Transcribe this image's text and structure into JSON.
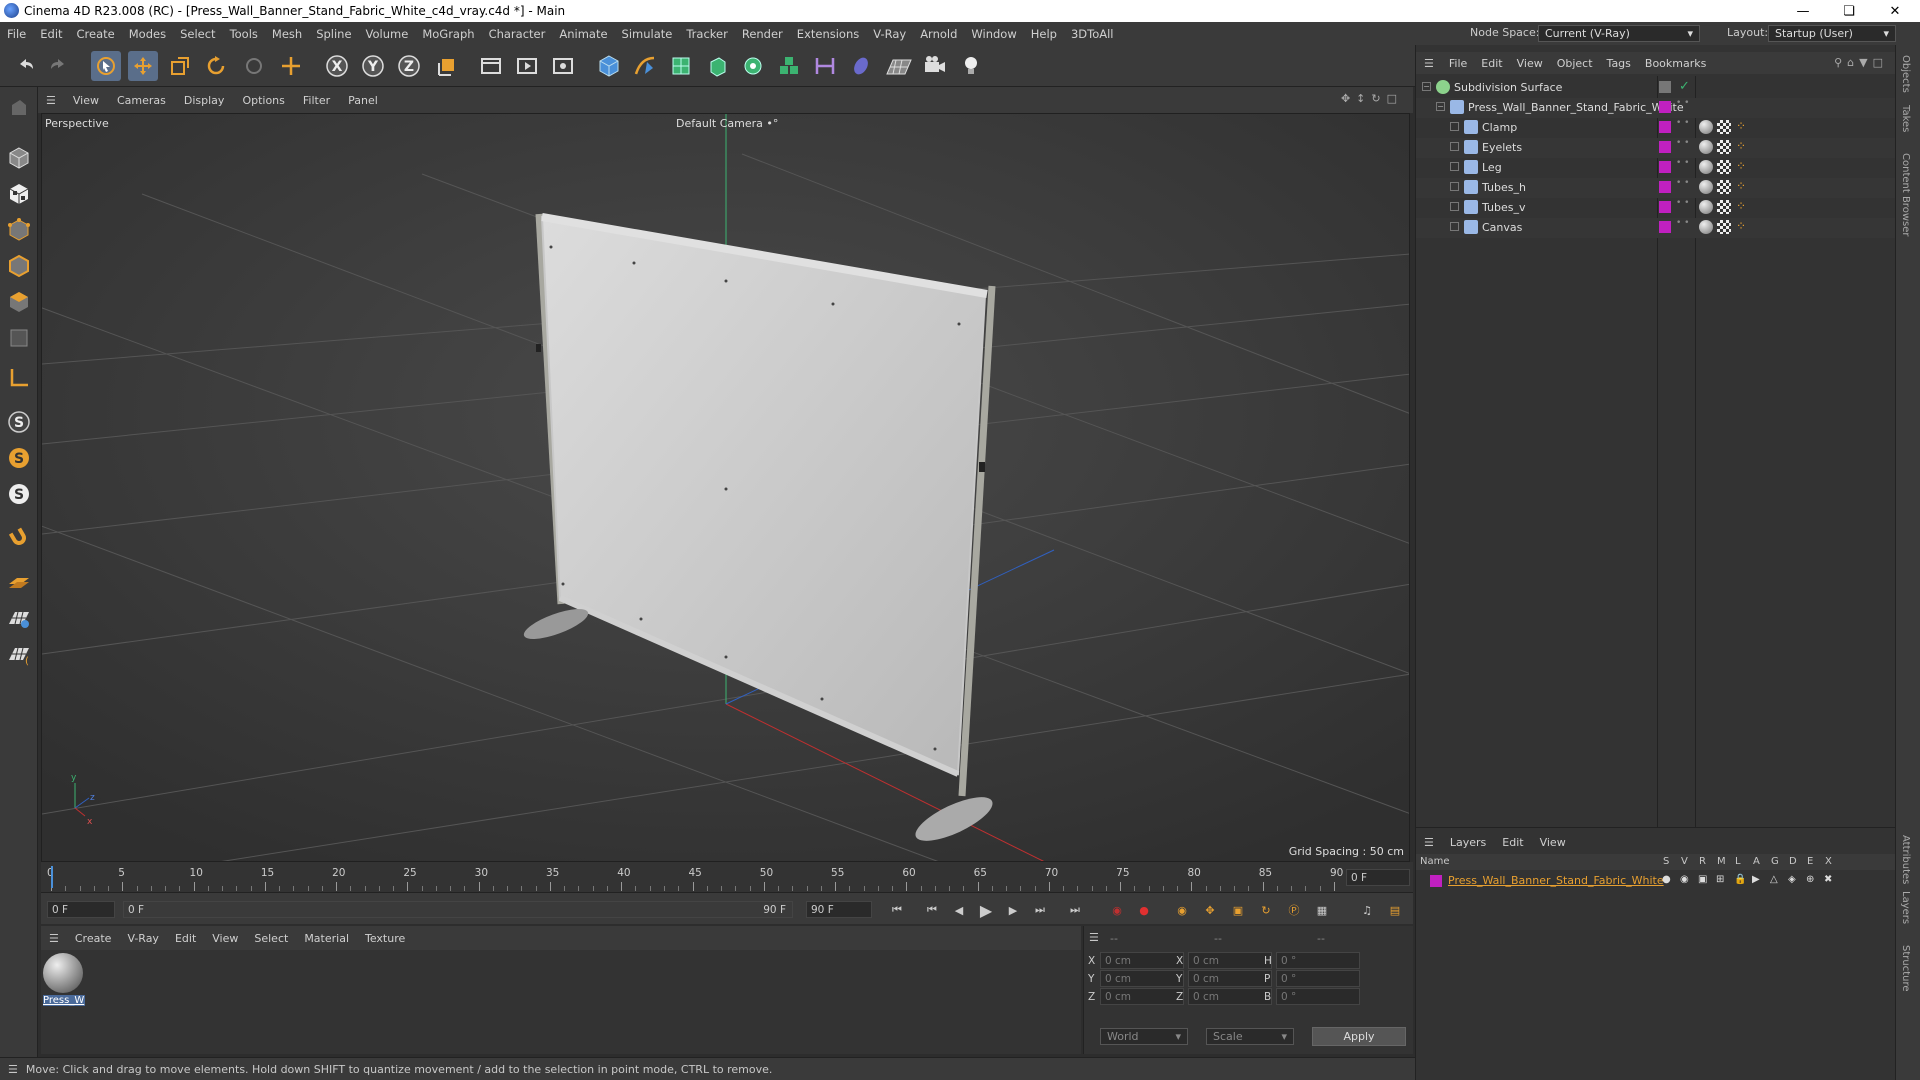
{
  "window": {
    "title": "Cinema 4D R23.008 (RC) - [Press_Wall_Banner_Stand_Fabric_White_c4d_vray.c4d *] - Main"
  },
  "menu": [
    "File",
    "Edit",
    "Create",
    "Modes",
    "Select",
    "Tools",
    "Mesh",
    "Spline",
    "Volume",
    "MoGraph",
    "Character",
    "Animate",
    "Simulate",
    "Tracker",
    "Render",
    "Extensions",
    "V-Ray",
    "Arnold",
    "Window",
    "Help",
    "3DToAll"
  ],
  "nodespace": {
    "label": "Node Space:",
    "value": "Current (V-Ray)"
  },
  "layout": {
    "label": "Layout:",
    "value": "Startup (User)"
  },
  "toolbar_icons": [
    "undo-icon",
    "redo-icon",
    "select-icon",
    "move-icon",
    "scale-icon",
    "rotate-icon",
    "live-select-icon",
    "transform-icon",
    "x-axis-icon",
    "y-axis-icon",
    "z-axis-icon",
    "coordinate-system-icon",
    "render-region-icon",
    "render-view-icon",
    "render-settings-icon",
    "cube-icon",
    "pen-icon",
    "subdivision-icon",
    "extrude-icon",
    "mograph-cloner-icon",
    "array-icon",
    "deformer-icon",
    "field-icon",
    "floor-icon",
    "camera-icon",
    "light-icon"
  ],
  "viewport": {
    "menu": [
      "View",
      "Cameras",
      "Display",
      "Options",
      "Filter",
      "Panel"
    ],
    "label": "Perspective",
    "camera": "Default Camera",
    "grid_spacing": "Grid Spacing : 50 cm"
  },
  "timeline": {
    "ticks": [
      "0",
      "5",
      "10",
      "15",
      "20",
      "25",
      "30",
      "35",
      "40",
      "45",
      "50",
      "55",
      "60",
      "65",
      "70",
      "75",
      "80",
      "85",
      "90"
    ],
    "current_frame": "0 F",
    "start": "0 F",
    "range_start": "0 F",
    "range_end": "90 F",
    "end": "90 F"
  },
  "material_menu": [
    "Create",
    "V-Ray",
    "Edit",
    "View",
    "Select",
    "Material",
    "Texture"
  ],
  "material": {
    "name": "Press_W"
  },
  "coords": {
    "header": [
      "--",
      "--",
      "--"
    ],
    "rows": [
      {
        "a": "X",
        "av": "0 cm",
        "b": "X",
        "bv": "0 cm",
        "c": "H",
        "cv": "0 °"
      },
      {
        "a": "Y",
        "av": "0 cm",
        "b": "Y",
        "bv": "0 cm",
        "c": "P",
        "cv": "0 °"
      },
      {
        "a": "Z",
        "av": "0 cm",
        "b": "Z",
        "bv": "0 cm",
        "c": "B",
        "cv": "0 °"
      }
    ],
    "mode1": "World",
    "mode2": "Scale",
    "apply": "Apply"
  },
  "status": "Move: Click and drag to move elements. Hold down SHIFT to quantize movement / add to the selection in point mode, CTRL to remove.",
  "objects_menu": [
    "File",
    "Edit",
    "View",
    "Object",
    "Tags",
    "Bookmarks"
  ],
  "objects": [
    {
      "name": "Subdivision Surface",
      "level": 0,
      "color": "#8cd28c"
    },
    {
      "name": "Press_Wall_Banner_Stand_Fabric_White",
      "level": 1,
      "color": "#9ab8e6"
    },
    {
      "name": "Clamp",
      "level": 2,
      "color": "#9ab8e6"
    },
    {
      "name": "Eyelets",
      "level": 2,
      "color": "#9ab8e6"
    },
    {
      "name": "Leg",
      "level": 2,
      "color": "#9ab8e6"
    },
    {
      "name": "Tubes_h",
      "level": 2,
      "color": "#9ab8e6"
    },
    {
      "name": "Tubes_v",
      "level": 2,
      "color": "#9ab8e6"
    },
    {
      "name": "Canvas",
      "level": 2,
      "color": "#9ab8e6"
    }
  ],
  "layers_menu": [
    "Layers",
    "Edit",
    "View"
  ],
  "layers_header": {
    "name": "Name",
    "cols": [
      "S",
      "V",
      "R",
      "M",
      "L",
      "A",
      "G",
      "D",
      "E",
      "X"
    ]
  },
  "layers": [
    {
      "name": "Press_Wall_Banner_Stand_Fabric_White",
      "color": "#c020c0"
    }
  ],
  "side_tabs": [
    "Objects",
    "Takes",
    "Content Browser",
    "Attributes",
    "Layers",
    "Structure"
  ]
}
